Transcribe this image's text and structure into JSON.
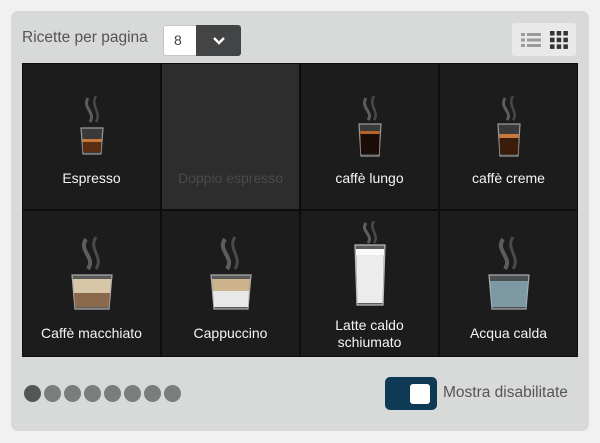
{
  "toolbar": {
    "per_page_label": "Ricette per pagina",
    "per_page_value": "8",
    "dropdown_icon": "chevron-down-icon",
    "view_list_icon": "list-view-icon",
    "view_grid_icon": "grid-view-icon"
  },
  "recipes": [
    {
      "label": "Espresso",
      "enabled": true
    },
    {
      "label": "Doppio espresso",
      "enabled": false
    },
    {
      "label": "caffè lungo",
      "enabled": true
    },
    {
      "label": "caffè creme",
      "enabled": true
    },
    {
      "label": "Caffè macchiato",
      "enabled": true
    },
    {
      "label": "Cappuccino",
      "enabled": true
    },
    {
      "label": "Latte caldo\nschiumato",
      "enabled": true
    },
    {
      "label": "Acqua calda",
      "enabled": true
    }
  ],
  "pager": {
    "pages": 8,
    "current": 1
  },
  "footer": {
    "toggle_label": "Mostra disabilitate",
    "toggle_on": true
  },
  "colors": {
    "toggle": "#0f3a55",
    "tile": "#1c1c1c",
    "panel": "#d8d9d9"
  }
}
